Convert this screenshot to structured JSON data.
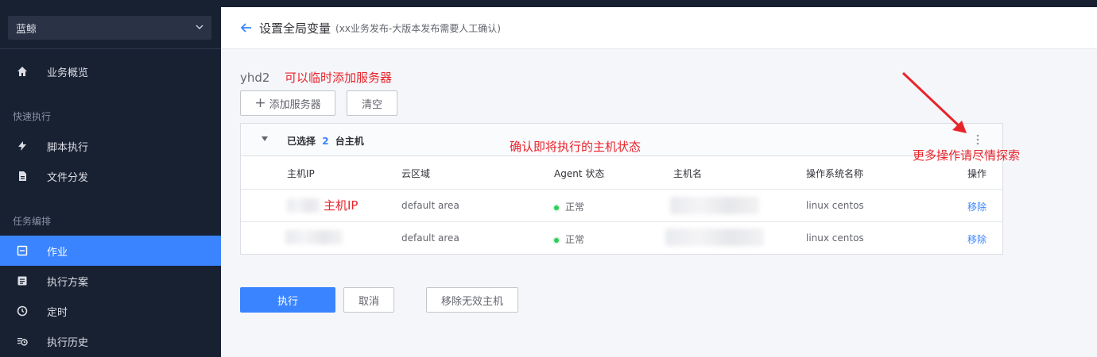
{
  "sidebar": {
    "business": "蓝鲸",
    "items": [
      {
        "label": "业务概览",
        "icon": "home-icon"
      },
      {
        "group": "快速执行"
      },
      {
        "label": "脚本执行",
        "icon": "lightning-icon"
      },
      {
        "label": "文件分发",
        "icon": "document-icon"
      },
      {
        "group": "任务编排"
      },
      {
        "label": "作业",
        "icon": "job-icon",
        "active": true
      },
      {
        "label": "执行方案",
        "icon": "list-icon"
      },
      {
        "label": "定时",
        "icon": "clock-icon"
      },
      {
        "label": "执行历史",
        "icon": "history-icon"
      }
    ]
  },
  "header": {
    "title": "设置全局变量",
    "subtitle": "(xx业务发布-大版本发布需要人工确认)"
  },
  "variable": {
    "name": "yhd2",
    "add_button": "添加服务器",
    "clear_button": "清空"
  },
  "annotations": {
    "add_server": "可以临时添加服务器",
    "confirm_hosts": "确认即将执行的主机状态",
    "more_ops": "更多操作请尽情探索",
    "host_ip": "主机IP"
  },
  "host_panel": {
    "selected_prefix": "已选择",
    "selected_count": "2",
    "selected_suffix": "台主机",
    "columns": [
      "主机IP",
      "云区域",
      "Agent 状态",
      "主机名",
      "操作系统名称",
      "操作"
    ],
    "rows": [
      {
        "cloud_area": "default area",
        "agent_status": "正常",
        "os": "linux centos",
        "action": "移除"
      },
      {
        "cloud_area": "default area",
        "agent_status": "正常",
        "os": "linux centos",
        "action": "移除"
      }
    ]
  },
  "footer": {
    "execute": "执行",
    "cancel": "取消",
    "remove_invalid": "移除无效主机"
  },
  "colors": {
    "primary": "#3a84ff",
    "sidebar_bg": "#182132",
    "annotation": "#e8242b",
    "status_ok": "#2dcb56"
  }
}
